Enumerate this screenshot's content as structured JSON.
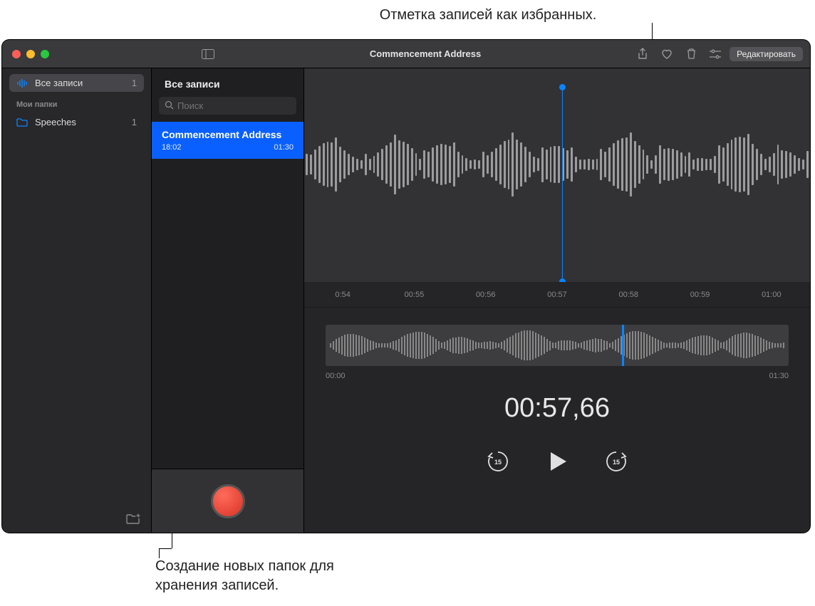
{
  "callouts": {
    "top": "Отметка записей как избранных.",
    "bottom": "Создание новых папок для хранения записей."
  },
  "toolbar": {
    "title": "Commencement Address",
    "edit_label": "Редактировать"
  },
  "sidebar": {
    "all_label": "Все записи",
    "all_count": "1",
    "folders_header": "Мои папки",
    "folders": [
      {
        "name": "Speeches",
        "count": "1"
      }
    ]
  },
  "list": {
    "header": "Все записи",
    "search_placeholder": "Поиск",
    "items": [
      {
        "title": "Commencement Address",
        "time": "18:02",
        "duration": "01:30"
      }
    ]
  },
  "player": {
    "ruler": [
      "0:54",
      "00:55",
      "00:56",
      "00:57",
      "00:58",
      "00:59",
      "01:00"
    ],
    "overview_start": "00:00",
    "overview_end": "01:30",
    "current_time": "00:57,66"
  }
}
